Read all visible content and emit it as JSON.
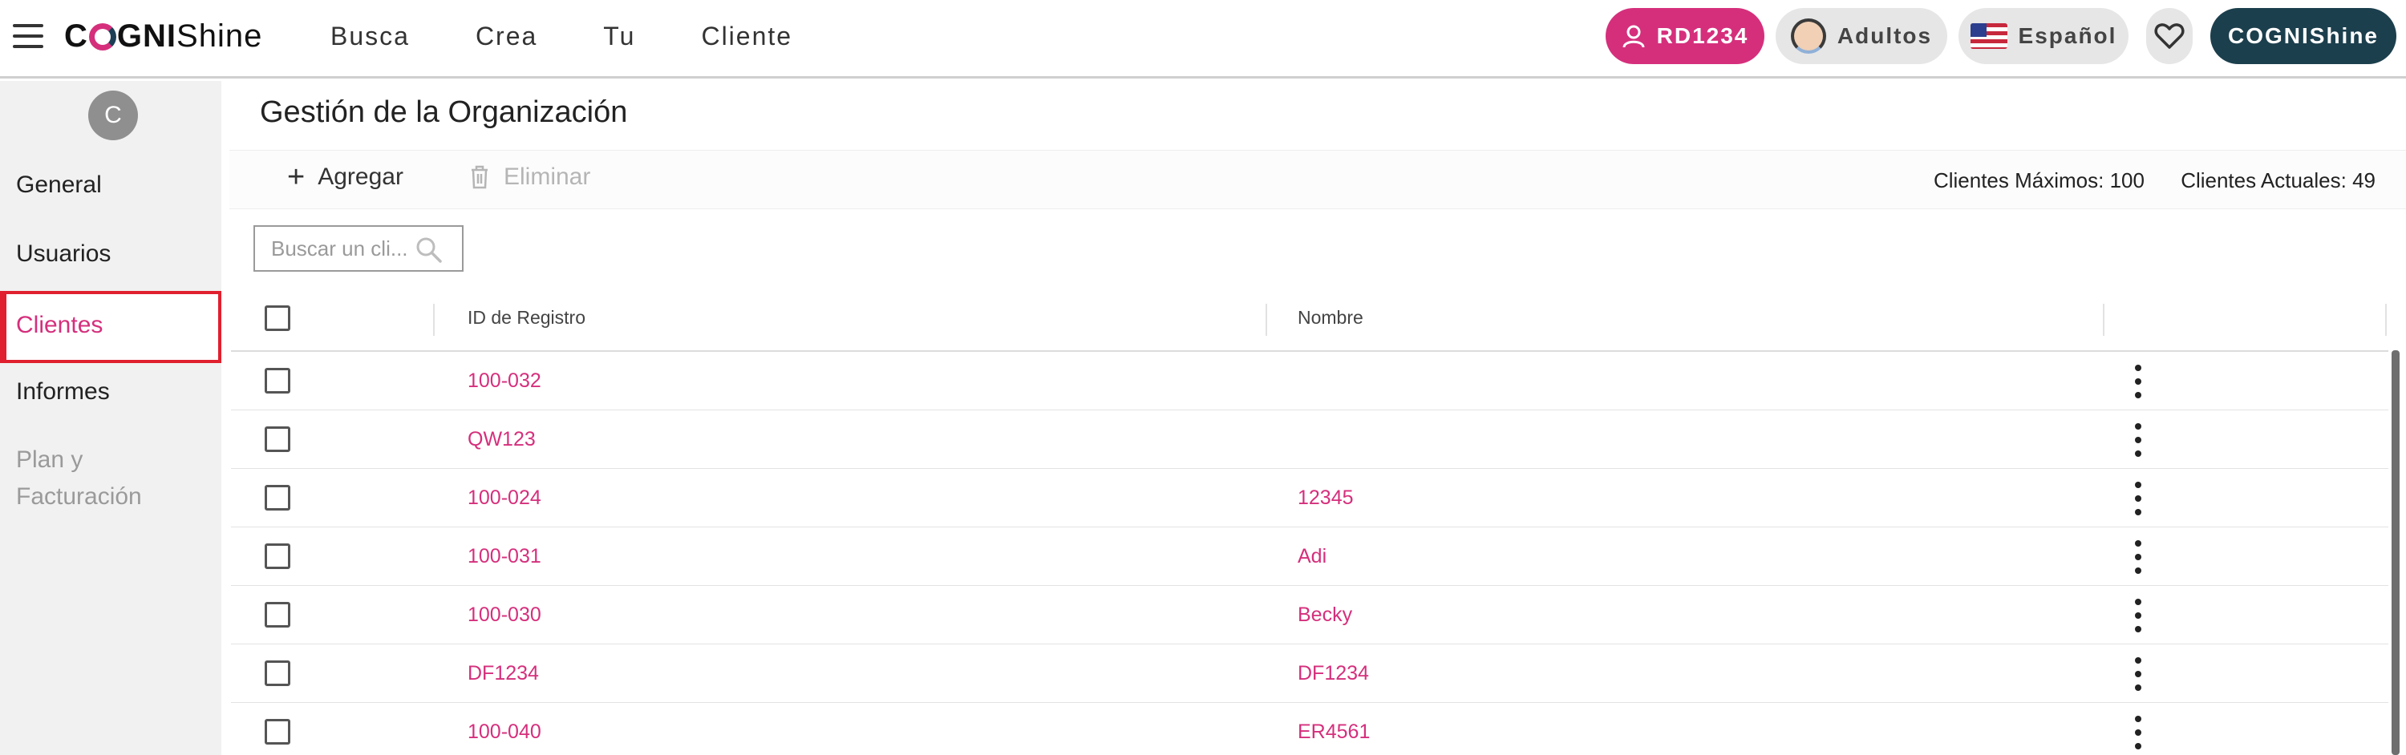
{
  "header": {
    "logo": {
      "prefix": "C",
      "middle": "GNI",
      "suffix": "Shine"
    },
    "nav": [
      "Busca",
      "Crea",
      "Tu",
      "Cliente"
    ],
    "user_pill": "RD1234",
    "audience_pill": "Adultos",
    "language_pill": "Español",
    "brand_pill": "COGNIShine",
    "colors": {
      "accent": "#d52f7c",
      "brand": "#1c3f4d"
    }
  },
  "sidebar": {
    "avatar_letter": "C",
    "items": [
      {
        "label": "General"
      },
      {
        "label": "Usuarios"
      },
      {
        "label": "Clientes"
      },
      {
        "label": "Informes"
      },
      {
        "label": "Plan y Facturación",
        "line1": "Plan y",
        "line2": "Facturación"
      }
    ]
  },
  "main": {
    "title": "Gestión de la Organización",
    "add_label": "Agregar",
    "delete_label": "Eliminar",
    "max_clients": "Clientes Máximos: 100",
    "current_clients": "Clientes Actuales: 49",
    "search_placeholder": "Buscar un cli..."
  },
  "table": {
    "headers": [
      "ID de Registro",
      "Nombre"
    ],
    "rows": [
      {
        "id": "100-032",
        "name": ""
      },
      {
        "id": "QW123",
        "name": ""
      },
      {
        "id": "100-024",
        "name": "12345"
      },
      {
        "id": "100-031",
        "name": "Adi"
      },
      {
        "id": "100-030",
        "name": "Becky"
      },
      {
        "id": "DF1234",
        "name": "DF1234"
      },
      {
        "id": "100-040",
        "name": "ER4561"
      }
    ]
  }
}
